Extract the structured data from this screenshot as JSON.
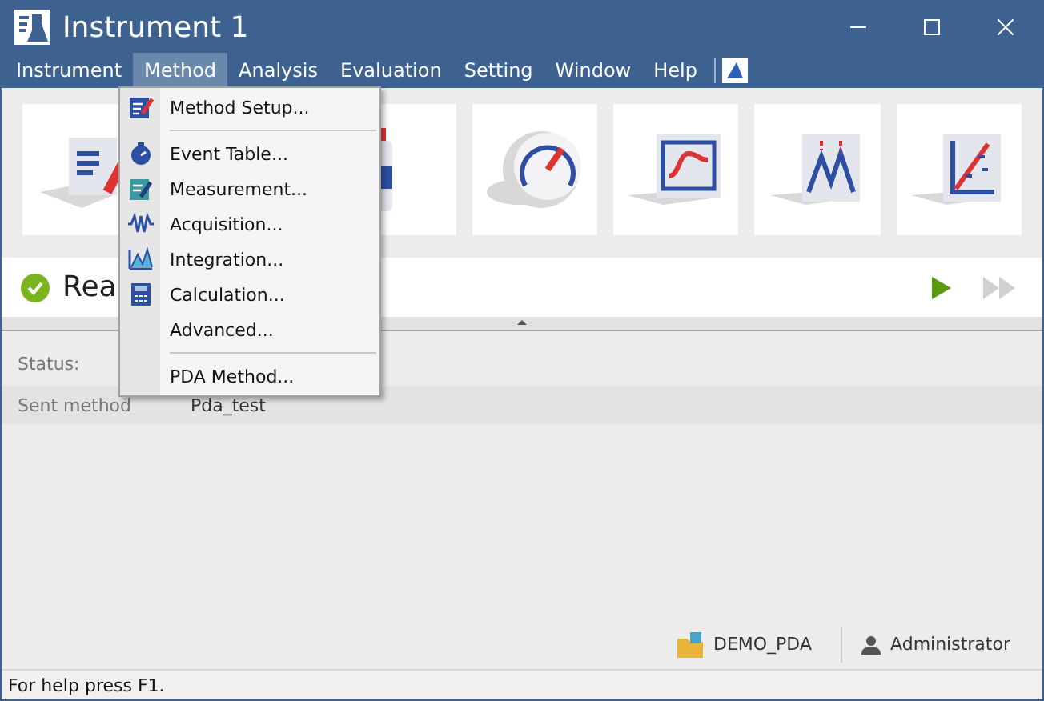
{
  "window": {
    "title": "Instrument 1"
  },
  "menu_bar": [
    {
      "label": "Instrument",
      "selected": false
    },
    {
      "label": "Method",
      "selected": true
    },
    {
      "label": "Analysis",
      "selected": false
    },
    {
      "label": "Evaluation",
      "selected": false
    },
    {
      "label": "Setting",
      "selected": false
    },
    {
      "label": "Window",
      "selected": false
    },
    {
      "label": "Help",
      "selected": false
    }
  ],
  "dropdown": [
    {
      "kind": "setup",
      "label": "Method Setup..."
    },
    {
      "kind": "separator"
    },
    {
      "kind": "timer",
      "label": "Event Table..."
    },
    {
      "kind": "edit",
      "label": "Measurement..."
    },
    {
      "kind": "wave",
      "label": "Acquisition..."
    },
    {
      "kind": "peak",
      "label": "Integration..."
    },
    {
      "kind": "calc",
      "label": "Calculation..."
    },
    {
      "kind": "plain",
      "label": "Advanced..."
    },
    {
      "kind": "separator"
    },
    {
      "kind": "plain",
      "label": "PDA Method..."
    }
  ],
  "toolbar_tiles": [
    {
      "kind": "document"
    },
    {
      "kind": "bottle"
    },
    {
      "kind": "gauge"
    },
    {
      "kind": "monitor"
    },
    {
      "kind": "peaks"
    },
    {
      "kind": "calibration"
    }
  ],
  "status": {
    "text": "Rea",
    "controls": [
      {
        "kind": "play",
        "disabled": false
      },
      {
        "kind": "fast_forward",
        "disabled": true
      }
    ]
  },
  "info_rows": [
    {
      "label": "Status:",
      "value": ""
    },
    {
      "label": "Sent method",
      "value": "Pda_test"
    }
  ],
  "footer": {
    "project": "DEMO_PDA",
    "user": "Administrator"
  },
  "status_bar": "For help press F1."
}
